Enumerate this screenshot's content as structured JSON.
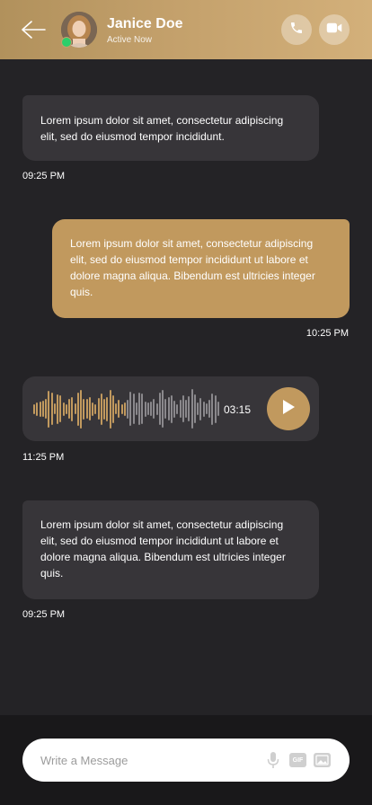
{
  "header": {
    "contact_name": "Janice Doe",
    "contact_status": "Active Now",
    "online_color": "#2ccf6a",
    "icons": [
      "back-arrow-icon",
      "phone-icon",
      "video-camera-icon"
    ]
  },
  "messages": [
    {
      "direction": "received",
      "text": "Lorem ipsum dolor sit amet, consectetur adipiscing elit, sed do eiusmod tempor incididunt.",
      "time": "09:25 PM"
    },
    {
      "direction": "sent",
      "text": "Lorem ipsum dolor sit amet, consectetur adipiscing elit, sed do eiusmod tempor incididunt ut labore et dolore magna aliqua. Bibendum est ultricies integer quis.",
      "time": "10:25 PM"
    },
    {
      "direction": "received",
      "type": "voice",
      "duration": "03:15",
      "time": "11:25 PM",
      "played_fraction": 0.5
    },
    {
      "direction": "received",
      "text": "Lorem ipsum dolor sit amet, consectetur adipiscing elit, sed do eiusmod tempor incididunt ut labore et dolore magna aliqua. Bibendum est ultricies integer quis.",
      "time": "09:25 PM"
    }
  ],
  "composer": {
    "placeholder": "Write a Message",
    "gif_label": "GIF"
  },
  "colors": {
    "accent": "#c1995e",
    "background": "#242326",
    "bubble_received": "#373539"
  }
}
